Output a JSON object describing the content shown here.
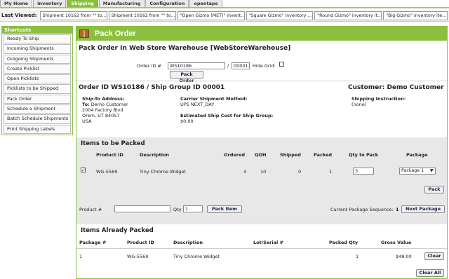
{
  "tabs": [
    "My Home",
    "Inventory",
    "Shipping",
    "Manufacturing",
    "Configuration",
    "opentaps"
  ],
  "last_viewed": {
    "label": "Last Viewed:",
    "items": [
      "Shipment 10162 from \"\" to...",
      "Shipment 10162 from \"\" to...",
      "\"Open Gizmo (MET)\" invent...",
      "\"Square Gizmo\" inventory ...",
      "\"Round Gizmo\" inventory it...",
      "\"Big Gizmo\" inventory ite..."
    ]
  },
  "sidebar": {
    "title": "Shortcuts",
    "items": [
      "Ready To Ship",
      "Incoming Shipments",
      "Outgoing Shipments",
      "Create Picklist",
      "Open Picklists",
      "Picklists to be Shipped",
      "Pack Order",
      "Schedule a Shipment",
      "Batch Schedule Shipments",
      "Print Shipping Labels"
    ]
  },
  "page": {
    "title": "Pack Order",
    "subtitle": "Pack Order In Web Store Warehouse [WebStoreWarehouse]",
    "order_id_label": "Order ID #",
    "order_id_value": "WS10186",
    "slash": "/",
    "ship_group_value": "00001",
    "hide_grid_label": "Hide Grid:",
    "pack_order_button": "Pack Order"
  },
  "order": {
    "heading": "Order ID WS10186 / Ship Group ID 00001",
    "customer": "Customer: Demo Customer",
    "ship_to_label": "Ship-To Address:",
    "to_label": "To:",
    "to_name": "Demo Customer",
    "address1": "2004 Factory Blvd",
    "address2": "Orem, UT 84057",
    "country": "USA",
    "carrier_label": "Carrier Shipment Method:",
    "carrier_value": "UPS   NEXT_DAY",
    "est_label": "Estimated Ship Cost for Ship Group:",
    "est_value": "$0.00",
    "instruction_label": "Shipping Instruction:",
    "instruction_value": "(none)"
  },
  "to_pack": {
    "title": "Items to be Packed",
    "headers": [
      "Product ID",
      "Description",
      "Ordered",
      "QOH",
      "Shipped",
      "Packed",
      "Qty to Pack",
      "Package"
    ],
    "row": {
      "checked": "✓",
      "product_id": "WG-5569",
      "description": "Tiny Chrome Widget",
      "ordered": "4",
      "qoh": "10",
      "shipped": "0",
      "packed": "1",
      "qty_to_pack": "3",
      "package": "Package 1"
    },
    "pack_button": "Pack",
    "product_label": "Product #",
    "qty_label": "Qty",
    "qty_value": "1",
    "pack_item_button": "Pack Item",
    "seq_label": "Current Package Sequence:",
    "seq_value": "1",
    "next_package_button": "Next Package"
  },
  "packed": {
    "title": "Items Already Packed",
    "headers": [
      "Package #",
      "Product ID",
      "Description",
      "Lot/Serial #",
      "Packed Qty",
      "Gross Value"
    ],
    "row": {
      "package": "1",
      "product_id": "WG-5569",
      "description": "Tiny Chrome Widget",
      "lot": "",
      "packed_qty": "1",
      "gross_value": "$48.00"
    },
    "clear_button": "Clear",
    "clear_all_button": "Clear All"
  }
}
